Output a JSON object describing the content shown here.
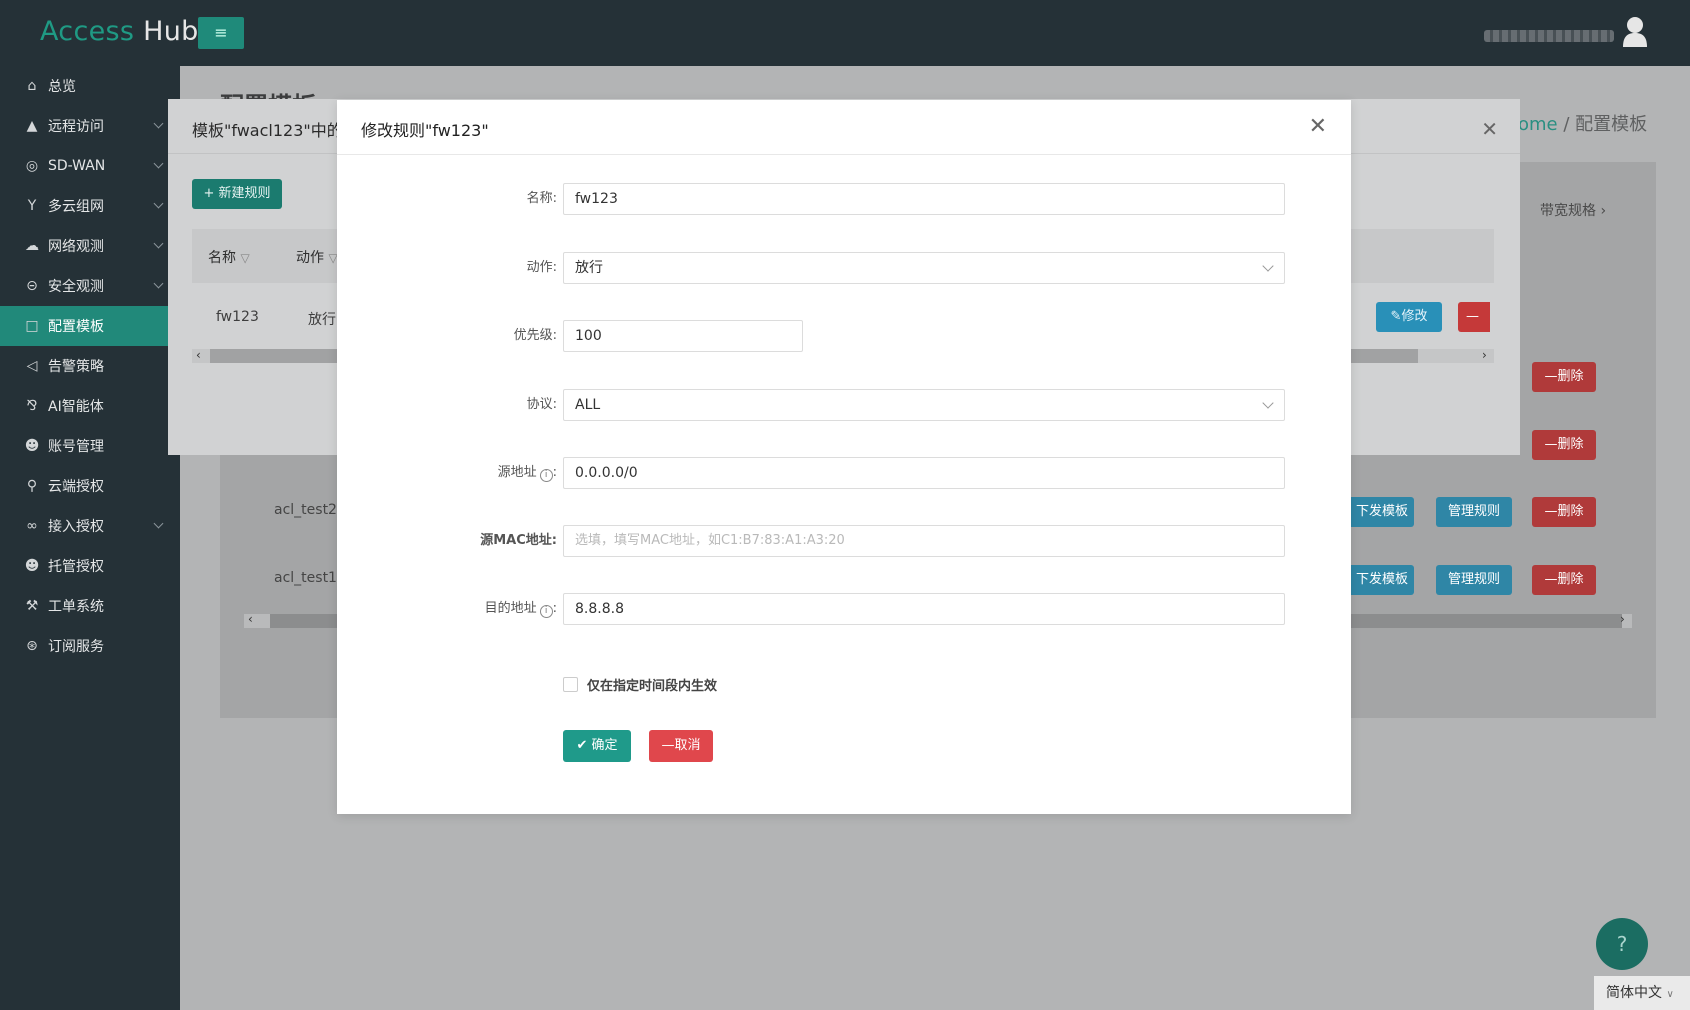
{
  "header": {
    "logo_part1": "Access",
    "logo_part2": "Hub",
    "menu_toggle_icon": "menu-fold-icon"
  },
  "sidebar": {
    "items": [
      {
        "label": "总览",
        "icon": "home-icon",
        "has_children": false
      },
      {
        "label": "远程访问",
        "icon": "rocket-icon",
        "has_children": true
      },
      {
        "label": "SD-WAN",
        "icon": "globe-icon",
        "has_children": true
      },
      {
        "label": "多云组网",
        "icon": "fork-icon",
        "has_children": true
      },
      {
        "label": "网络观测",
        "icon": "cloud-icon",
        "has_children": true
      },
      {
        "label": "安全观测",
        "icon": "minus-circle-icon",
        "has_children": true
      },
      {
        "label": "配置模板",
        "icon": "file-icon",
        "has_children": false,
        "active": true
      },
      {
        "label": "告警策略",
        "icon": "megaphone-icon",
        "has_children": false
      },
      {
        "label": "AI智能体",
        "icon": "ai-icon",
        "has_children": false
      },
      {
        "label": "账号管理",
        "icon": "user-icon",
        "has_children": false
      },
      {
        "label": "云端授权",
        "icon": "key-icon",
        "has_children": false
      },
      {
        "label": "接入授权",
        "icon": "link-icon",
        "has_children": true
      },
      {
        "label": "托管授权",
        "icon": "user-shield-icon",
        "has_children": false
      },
      {
        "label": "工单系统",
        "icon": "wrench-icon",
        "has_children": false
      },
      {
        "label": "订阅服务",
        "icon": "cart-icon",
        "has_children": false
      }
    ]
  },
  "page": {
    "title": "配置模板",
    "breadcrumb_home": "ome",
    "breadcrumb_sep": "/",
    "breadcrumb_current": "配置模板",
    "bandwidth_tab": "带宽规格",
    "rows": [
      {
        "name": "acl_test2"
      },
      {
        "name": "acl_test1"
      }
    ],
    "btn_delete": "删除",
    "btn_publish": "下发模板",
    "btn_manage": "管理规则",
    "help_icon": "question-icon",
    "language": "简体中文"
  },
  "rules_modal": {
    "title": "模板\"fwacl123\"中的",
    "btn_new": "新建规则",
    "col_name": "名称",
    "col_action": "动作",
    "row": {
      "name": "fw123",
      "action": "放行"
    },
    "btn_edit": "修改",
    "btn_delete": "删"
  },
  "edit_modal": {
    "title": "修改规则\"fw123\"",
    "fields": {
      "name": {
        "label": "名称:",
        "value": "fw123"
      },
      "action": {
        "label": "动作:",
        "value": "放行"
      },
      "priority": {
        "label": "优先级:",
        "value": "100"
      },
      "protocol": {
        "label": "协议:",
        "value": "ALL"
      },
      "src_addr": {
        "label": "源地址",
        "value": "0.0.0.0/0"
      },
      "src_mac": {
        "label": "源MAC地址:",
        "placeholder": "选填，填写MAC地址，如C1:B7:83:A1:A3:20"
      },
      "dst_addr": {
        "label": "目的地址",
        "value": "8.8.8.8"
      }
    },
    "checkbox_label": "仅在指定时间段内生效",
    "checkbox_checked": false,
    "btn_ok": "确定",
    "btn_cancel": "取消"
  },
  "colors": {
    "header_bg": "#253137",
    "accent": "#1f9a8a",
    "danger": "#e0474c",
    "info": "#2990b8"
  }
}
